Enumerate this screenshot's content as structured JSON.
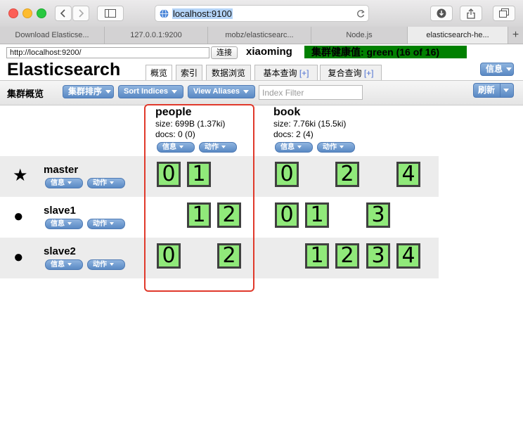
{
  "browser": {
    "url": "localhost:9100",
    "tabs": [
      {
        "label": "Download Elasticse..."
      },
      {
        "label": "127.0.0.1:9200"
      },
      {
        "label": "mobz/elasticsearc..."
      },
      {
        "label": "Node.js"
      },
      {
        "label": "elasticsearch-he..."
      }
    ],
    "new_tab": "+"
  },
  "connection": {
    "url_value": "http://localhost:9200/",
    "connect_label": "连接",
    "cluster_name": "xiaoming",
    "health_text": "集群健康值: green (16 of 16)"
  },
  "app": {
    "logo": "Elasticsearch",
    "tabs": [
      {
        "label": "概览"
      },
      {
        "label": "索引"
      },
      {
        "label": "数据浏览"
      },
      {
        "label": "基本查询",
        "plus": "[+]"
      },
      {
        "label": "复合查询",
        "plus": "[+]"
      }
    ],
    "info_label": "信息"
  },
  "toolbar": {
    "title": "集群概览",
    "sort_cluster": "集群排序",
    "sort_indices": "Sort Indices",
    "view_aliases": "View Aliases",
    "filter_placeholder": "Index Filter",
    "refresh": "刷新"
  },
  "indices": [
    {
      "name": "people",
      "size": "size: 699B (1.37ki)",
      "docs": "docs: 0 (0)",
      "info": "信息",
      "action": "动作"
    },
    {
      "name": "book",
      "size": "size: 7.76ki (15.5ki)",
      "docs": "docs: 2 (4)",
      "info": "信息",
      "action": "动作"
    }
  ],
  "nodes": [
    {
      "name": "master",
      "symbol": "★",
      "info": "信息",
      "action": "动作",
      "people": [
        "0",
        "1",
        "",
        ""
      ],
      "book": [
        "0",
        "",
        "2",
        "",
        "4"
      ]
    },
    {
      "name": "slave1",
      "symbol": "●",
      "info": "信息",
      "action": "动作",
      "people": [
        "",
        "1",
        "2"
      ],
      "book": [
        "0",
        "1",
        "",
        "3",
        ""
      ]
    },
    {
      "name": "slave2",
      "symbol": "●",
      "info": "信息",
      "action": "动作",
      "people": [
        "0",
        "",
        "2"
      ],
      "book": [
        "",
        "1",
        "2",
        "3",
        "4"
      ]
    }
  ],
  "colors": {
    "health": "#008000",
    "shard": "#90e97a",
    "highlight": "#e0392b"
  }
}
